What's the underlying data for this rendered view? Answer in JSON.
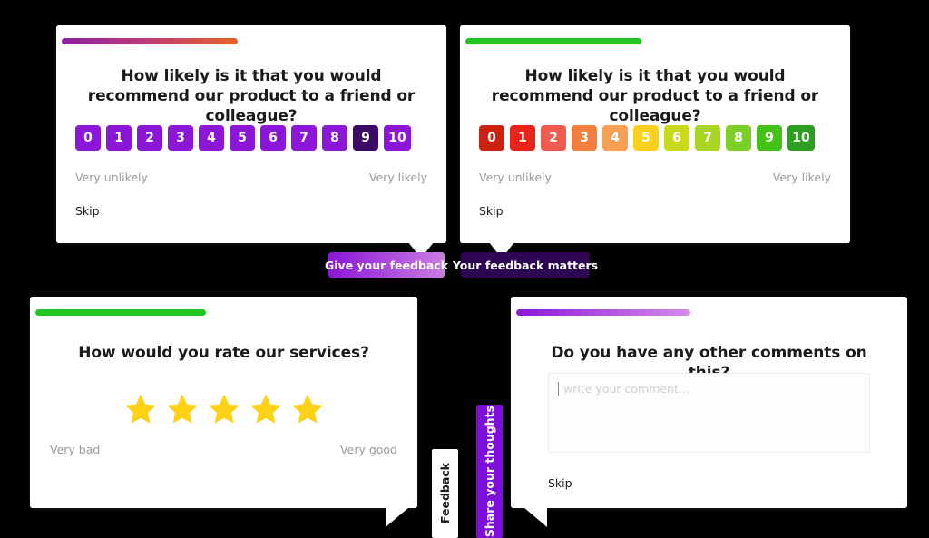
{
  "background_color": "#000000",
  "cards": {
    "nps_purple": {
      "progress": {
        "percent": 45,
        "gradient_from": "#8e1f9e",
        "gradient_to": "#e8622a"
      },
      "question": "How likely is it that you would recommend our product to a friend or colleague?",
      "scale": {
        "options": [
          "0",
          "1",
          "2",
          "3",
          "4",
          "5",
          "6",
          "7",
          "8",
          "9",
          "10"
        ],
        "selected": "9",
        "base_color": "#8b16d8",
        "selected_color": "#3d0b66"
      },
      "anchor_low": "Very unlikely",
      "anchor_high": "Very likely",
      "skip_label": "Skip"
    },
    "nps_colored": {
      "progress": {
        "percent": 45,
        "gradient_from": "#22c522",
        "gradient_to": "#22c522"
      },
      "question": "How likely is it that you would recommend our product to a friend or colleague?",
      "scale": {
        "options": [
          "0",
          "1",
          "2",
          "3",
          "4",
          "5",
          "6",
          "7",
          "8",
          "9",
          "10"
        ],
        "selected": "0",
        "colors": [
          "#cc2010",
          "#ea2418",
          "#ef5b4c",
          "#f4803f",
          "#f7a055",
          "#fbd020",
          "#cada1a",
          "#a8d423",
          "#7ece28",
          "#44c21a",
          "#2e9e22"
        ]
      },
      "anchor_low": "Very unlikely",
      "anchor_high": "Very likely",
      "skip_label": "Skip"
    },
    "star_rating": {
      "progress": {
        "percent": 47,
        "gradient_from": "#22c522",
        "gradient_to": "#22c522"
      },
      "question": "How would you rate our services?",
      "stars": {
        "total": 5,
        "filled": 5,
        "color": "#fcd116"
      },
      "anchor_low": "Very bad",
      "anchor_high": "Very good"
    },
    "comment": {
      "progress": {
        "percent": 46,
        "gradient_from": "#8b16d8",
        "gradient_to": "#d58ce8"
      },
      "question": "Do you have any other comments on this?",
      "comment_placeholder": "write your comment...",
      "comment_value": "",
      "skip_label": "Skip"
    }
  },
  "tabs": {
    "give_feedback": {
      "label": "Give your feedback",
      "gradient_from": "#8b16d8",
      "gradient_to": "#cb7de0",
      "text_color": "#ffffff"
    },
    "feedback_matters": {
      "label": "Your feedback matters",
      "background": "#2c0452",
      "text_color": "#ffffff"
    },
    "feedback_vertical": {
      "label": "Feedback",
      "background": "#ffffff",
      "text_color": "#1b1b1b"
    },
    "share_thoughts_vertical": {
      "label": "Share your thoughts",
      "background": "#7d0fdb",
      "text_color": "#ffffff"
    }
  }
}
